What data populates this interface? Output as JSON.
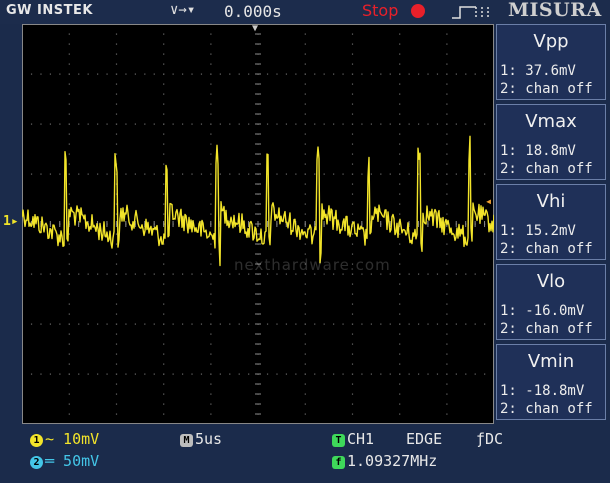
{
  "brand": "GW INSTEK",
  "watermark": "MISURA",
  "site_watermark": "nexthardware.com",
  "header": {
    "trigger_icons": "∨→▾",
    "horizontal_position": "0.000s",
    "run_state": "Stop"
  },
  "measurements": [
    {
      "title": "Vpp",
      "ch1": "1: 37.6mV",
      "ch2": "2: chan off"
    },
    {
      "title": "Vmax",
      "ch1": "1: 18.8mV",
      "ch2": "2: chan off"
    },
    {
      "title": "Vhi",
      "ch1": "1: 15.2mV",
      "ch2": "2: chan off"
    },
    {
      "title": "Vlo",
      "ch1": "1: -16.0mV",
      "ch2": "2: chan off"
    },
    {
      "title": "Vmin",
      "ch1": "1: -18.8mV",
      "ch2": "2: chan off"
    }
  ],
  "footer": {
    "ch1_badge": "1",
    "ch1_scale": "∼ 10mV",
    "ch2_badge": "2",
    "ch2_scale": "═ 50mV",
    "time_badge": "M",
    "timebase": "5us",
    "trig_badge": "T",
    "trig_source": "CH1",
    "trig_type": "EDGE",
    "trig_coupling": "ƒDC",
    "freq_badge": "f",
    "frequency": "1.09327MHz"
  },
  "markers": {
    "ch1": "1▸",
    "trigger_level": "◂",
    "trigger_position": "▼"
  },
  "colors": {
    "ch1": "#f2e42a",
    "ch2": "#44c6e8",
    "stop": "#e8202a",
    "trigger": "#3ed85a"
  }
}
